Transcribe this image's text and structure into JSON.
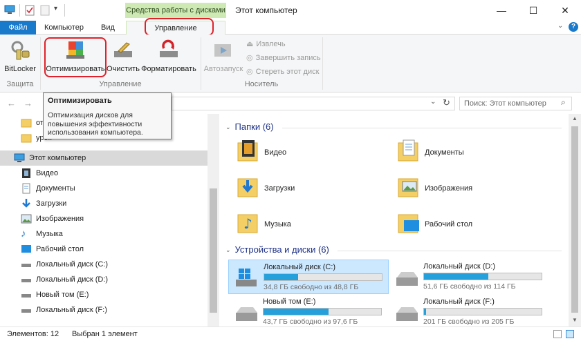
{
  "titlebar": {
    "context_tab": "Средства работы с дисками",
    "window_title": "Этот компьютер",
    "minimize": "—",
    "maximize": "☐",
    "close": "✕"
  },
  "tabs": {
    "file": "Файл",
    "computer": "Компьютер",
    "view": "Вид",
    "manage": "Управление"
  },
  "ribbon": {
    "bitlocker": "BitLocker",
    "optimize": "Оптимизировать",
    "cleanup": "Очистить",
    "format": "Форматировать",
    "autoplay": "Автозапуск",
    "eject": "Извлечь",
    "finish_burn": "Завершить запись",
    "erase": "Стереть этот диск",
    "group_protection": "Защита",
    "group_manage": "Управление",
    "group_media": "Носитель"
  },
  "tooltip": {
    "title": "Оптимизировать",
    "body": "Оптимизация дисков для повышения эффективности использования компьютера."
  },
  "search": {
    "placeholder": "Поиск: Этот компьютер"
  },
  "nav": {
    "partial1": "отк",
    "partial2": "урок",
    "this_pc": "Этот компьютер",
    "items": [
      "Видео",
      "Документы",
      "Загрузки",
      "Изображения",
      "Музыка",
      "Рабочий стол",
      "Локальный диск (C:)",
      "Локальный диск (D:)",
      "Новый том (E:)",
      "Локальный диск (F:)"
    ]
  },
  "content": {
    "folders_header": "Папки (6)",
    "folders": [
      "Видео",
      "Документы",
      "Загрузки",
      "Изображения",
      "Музыка",
      "Рабочий стол"
    ],
    "devices_header": "Устройства и диски (6)",
    "drives": [
      {
        "name": "Локальный диск (C:)",
        "free": "34,8 ГБ свободно из 48,8 ГБ",
        "used": 0.287
      },
      {
        "name": "Локальный диск (D:)",
        "free": "51,6 ГБ свободно из 114 ГБ",
        "used": 0.547
      },
      {
        "name": "Новый том (E:)",
        "free": "43,7 ГБ свободно из 97,6 ГБ",
        "used": 0.552
      },
      {
        "name": "Локальный диск (F:)",
        "free": "201 ГБ свободно из 205 ГБ",
        "used": 0.02
      }
    ]
  },
  "status": {
    "items": "Элементов: 12",
    "selected": "Выбран 1 элемент"
  },
  "colors": {
    "accent": "#1979ca",
    "context": "#cfe9b4",
    "bar": "#26a0da",
    "highlight": "#e0202a"
  }
}
